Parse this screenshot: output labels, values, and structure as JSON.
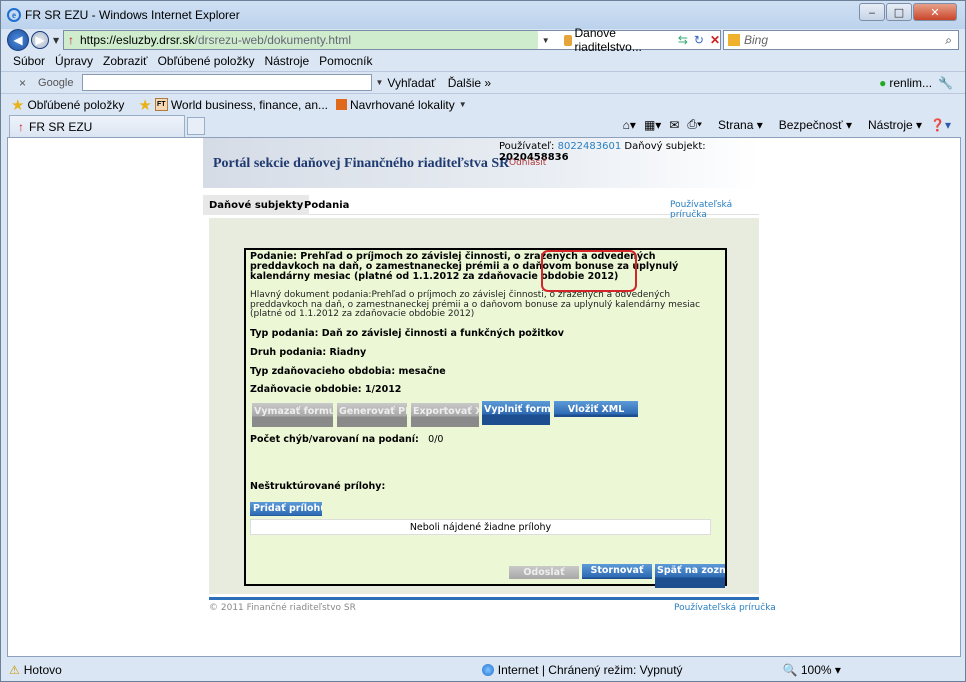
{
  "window": {
    "title": "FR SR EZU - Windows Internet Explorer",
    "min": "‒",
    "max": "□",
    "close": "✕"
  },
  "address": {
    "url_host": "https://esluzby.drsr.sk",
    "url_path": "/drsrezu-web/dokumenty.html",
    "cert_name": "Danove riaditelstvo...",
    "search_placeholder": "Bing"
  },
  "menu": [
    "Súbor",
    "Úpravy",
    "Zobraziť",
    "Obľúbené položky",
    "Nástroje",
    "Pomocník"
  ],
  "googlebar": {
    "logo": "Google",
    "search_btn": "Vyhľadať",
    "more": "Ďalšie »",
    "user": "renlim..."
  },
  "favorites": {
    "label": "Obľúbené položky",
    "items": [
      "World business, finance, an...",
      "Navrhované lokality"
    ]
  },
  "tab": {
    "label": "FR SR EZU"
  },
  "commandbar": {
    "page": "Strana",
    "security": "Bezpečnosť",
    "tools": "Nástroje"
  },
  "status": {
    "text": "Hotovo",
    "zone": "Internet | Chránený režim: Vypnutý",
    "zoom": "100%"
  },
  "page": {
    "portal_title": "Portál sekcie daňovej Finančného riaditeľstva SR",
    "user_label": "Používateľ:",
    "user_id": "8022483601",
    "subject_label": "Daňový subjekt:",
    "subject_id": "2020458836",
    "logout": "Odhlásiť",
    "nav": [
      "Daňové subjekty",
      "Podania"
    ],
    "guide": "Používateľská príručka",
    "form": {
      "title": "Podanie: Prehľad o príjmoch zo závislej činnosti, o zrazených a odvedených preddavkoch na daň, o zamestnaneckej prémii a o daňovom bonuse za uplynulý kalendárny mesiac (platné od 1.1.2012 za zdaňovacie obdobie 2012)",
      "desc": "Hlavný dokument podania:Prehľad o príjmoch zo závislej činnosti, o zrazených a odvedených preddavkoch na daň, o zamestnaneckej prémii a o daňovom bonuse za uplynulý kalendárny mesiac (platné od 1.1.2012 za zdaňovacie obdobie 2012)",
      "typ": "Typ podania: Daň zo závislej činnosti a funkčných požitkov",
      "druh": "Druh podania: Riadny",
      "obdobie_typ": "Typ zdaňovacieho obdobia: mesačne",
      "obdobie": "Zdaňovacie obdobie: 1/2012",
      "buttons": [
        "Vymazať formulá",
        "Generovať PDF",
        "Exportovať XM",
        "Vyplniť formul",
        "Vložiť XML"
      ],
      "errors_label": "Počet chýb/varovaní na podaní:",
      "errors_value": "0/0",
      "attachments_label": "Neštruktúrované prílohy:",
      "add_attachment": "Pridať prílohu",
      "no_attachments": "Neboli nájdené žiadne prílohy",
      "bottom_buttons": [
        "Odoslať",
        "Stornovať",
        "Späť na zoznam"
      ]
    },
    "footer": {
      "copyright": "© 2011 Finančné riaditeľstvo SR",
      "guide": "Používateľská príručka"
    }
  }
}
